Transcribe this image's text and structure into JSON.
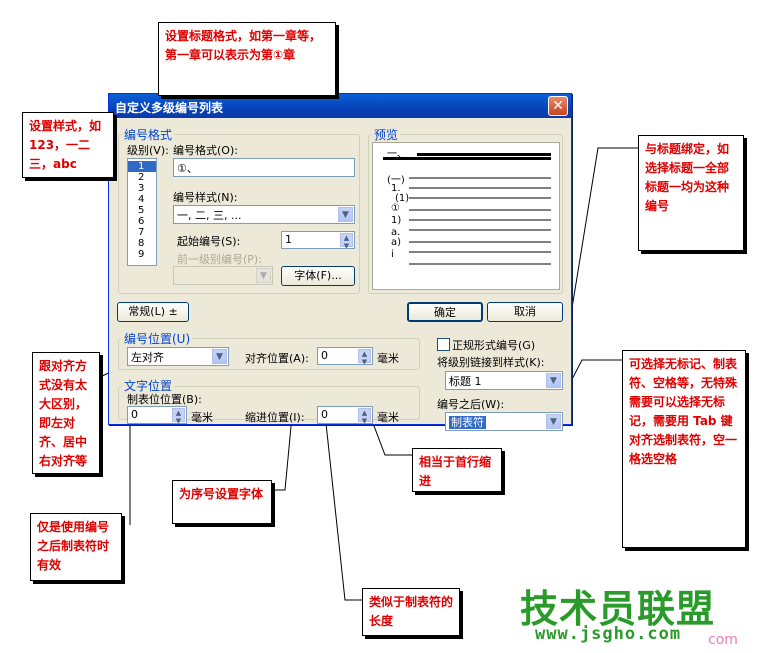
{
  "dialog": {
    "title": "自定义多级编号列表",
    "close_symbol": "✕",
    "number_format_group": "编号格式",
    "level_label": "级别(V):",
    "levels": [
      "1",
      "2",
      "3",
      "4",
      "5",
      "6",
      "7",
      "8",
      "9"
    ],
    "number_format_label": "编号格式(O):",
    "number_format_value": "①、",
    "number_style_label": "编号样式(N):",
    "number_style_value": "一, 二, 三, ...",
    "start_at_label": "起始编号(S):",
    "start_at_value": "1",
    "prev_level_label": "前一级别编号(P):",
    "font_button": "字体(F)...",
    "preview_group": "预览",
    "preview_items": [
      "一、",
      "(一)",
      "1.",
      "(1)",
      "①",
      "1)",
      "a.",
      "a)",
      "i"
    ],
    "normal_button": "常规(L) ±",
    "ok_button": "确定",
    "cancel_button": "取消",
    "number_position_group": "编号位置(U)",
    "alignment_value": "左对齐",
    "aligned_at_label": "对齐位置(A):",
    "aligned_at_value": "0",
    "unit_cm": "毫米",
    "legal_style_label": "正规形式编号(G)",
    "link_style_label": "将级别链接到样式(K):",
    "link_style_value": "标题 1",
    "text_position_group": "文字位置",
    "tab_pos_label": "制表位位置(B):",
    "tab_pos_value": "0",
    "indent_label": "缩进位置(I):",
    "indent_value": "0",
    "follow_number_label": "编号之后(W):",
    "follow_number_value": "制表符"
  },
  "callouts": {
    "c1": "设置标题格式，如第一章等，第一章可以表示为第①章",
    "c2": "设置样式，如 123，一二三，abc",
    "c3": "与标题绑定，如选择标题一全部标题一均为这种编号",
    "c4": "跟对齐方式没有太大区别，即左对齐、居中右对齐等",
    "c5": "可选择无标记、制表符、空格等，无特殊需要可以选择无标记，需要用 Tab 键对齐选制表符，空一格选空格",
    "c6": "相当于首行缩进",
    "c7": "为序号设置字体",
    "c8": "仅是使用编号之后制表符时有效",
    "c9": "类似于制表符的长度"
  },
  "watermark": {
    "brand": "技术员联盟",
    "url": "www.jsgho.com",
    "url2": "com"
  },
  "colors": {
    "title_bar": "#0842b8",
    "callout_text": "#e00000",
    "watermark": "#2a9a2a"
  }
}
